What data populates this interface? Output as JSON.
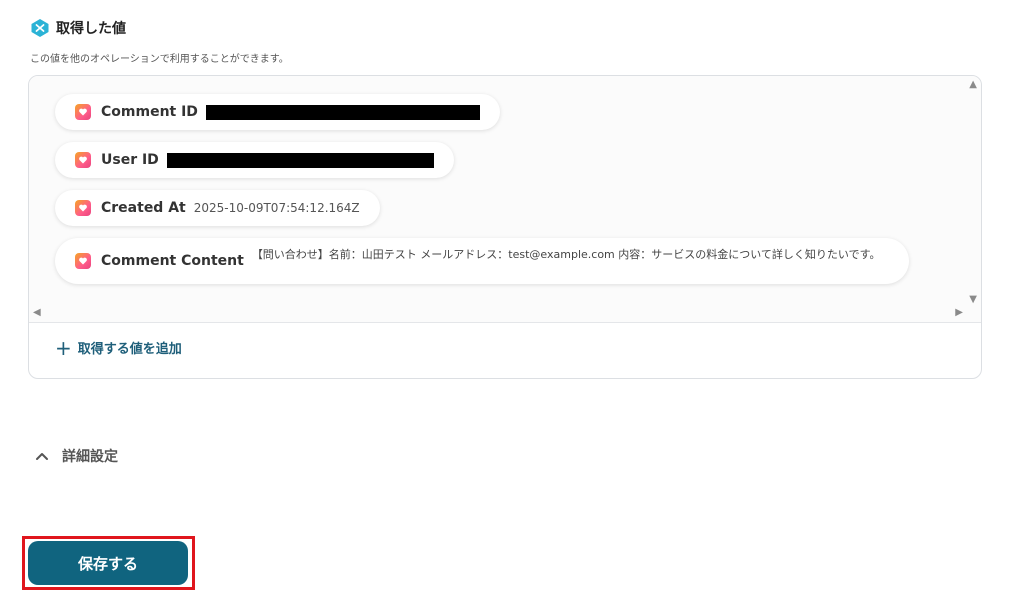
{
  "section": {
    "title": "取得した値",
    "subtitle": "この値を他のオペレーションで利用することができます。"
  },
  "fields": [
    {
      "label": "Comment ID",
      "value": "",
      "redacted": true
    },
    {
      "label": "User ID",
      "value": "",
      "redacted": true
    },
    {
      "label": "Created At",
      "value": "2025-10-09T07:54:12.164Z",
      "redacted": false
    },
    {
      "label": "Comment Content",
      "value": "【問い合わせ】名前：山田テスト メールアドレス：test@example.com 内容：サービスの料金について詳しく知りたいです。",
      "redacted": false
    }
  ],
  "add_value": {
    "label": "取得する値を追加"
  },
  "details": {
    "label": "詳細設定"
  },
  "save_button": {
    "label": "保存する"
  },
  "colors": {
    "accent": "#10647f",
    "link": "#1f5f7a",
    "highlight_border": "#e0161d"
  }
}
